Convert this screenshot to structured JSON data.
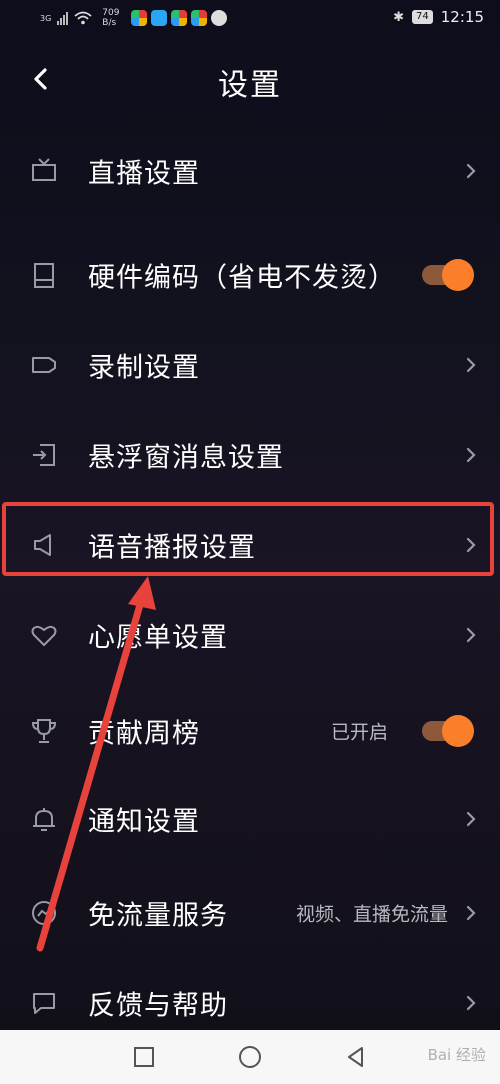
{
  "status_bar": {
    "network": "3G",
    "speed_value": "709",
    "speed_unit": "B/s",
    "battery": "74",
    "time": "12:15"
  },
  "header": {
    "title": "设置"
  },
  "settings": [
    {
      "key": "live",
      "label": "直播设置",
      "icon": "tv-icon",
      "control": "chevron"
    },
    {
      "key": "hw",
      "label": "硬件编码（省电不发烫）",
      "icon": "phone-icon",
      "control": "toggle",
      "toggle_on": true
    },
    {
      "key": "record",
      "label": "录制设置",
      "icon": "camera-icon",
      "control": "chevron"
    },
    {
      "key": "float",
      "label": "悬浮窗消息设置",
      "icon": "floating-window-icon",
      "control": "chevron"
    },
    {
      "key": "voice",
      "label": "语音播报设置",
      "icon": "speaker-icon",
      "control": "chevron",
      "highlighted": true
    },
    {
      "key": "wish",
      "label": "心愿单设置",
      "icon": "heart-icon",
      "control": "chevron"
    },
    {
      "key": "rank",
      "label": "贡献周榜",
      "icon": "trophy-icon",
      "control": "toggle",
      "value": "已开启",
      "toggle_on": true
    },
    {
      "key": "notify",
      "label": "通知设置",
      "icon": "bell-icon",
      "control": "chevron"
    },
    {
      "key": "free",
      "label": "免流量服务",
      "icon": "data-free-icon",
      "control": "chevron",
      "value": "视频、直播免流量"
    },
    {
      "key": "feedback",
      "label": "反馈与帮助",
      "icon": "chat-icon",
      "control": "chevron"
    }
  ],
  "annotation": {
    "highlight_color": "#e8423c"
  },
  "colors": {
    "toggle_knob": "#fb7f2b",
    "toggle_track": "#8c5a3b"
  },
  "watermark": "Bai 经验"
}
